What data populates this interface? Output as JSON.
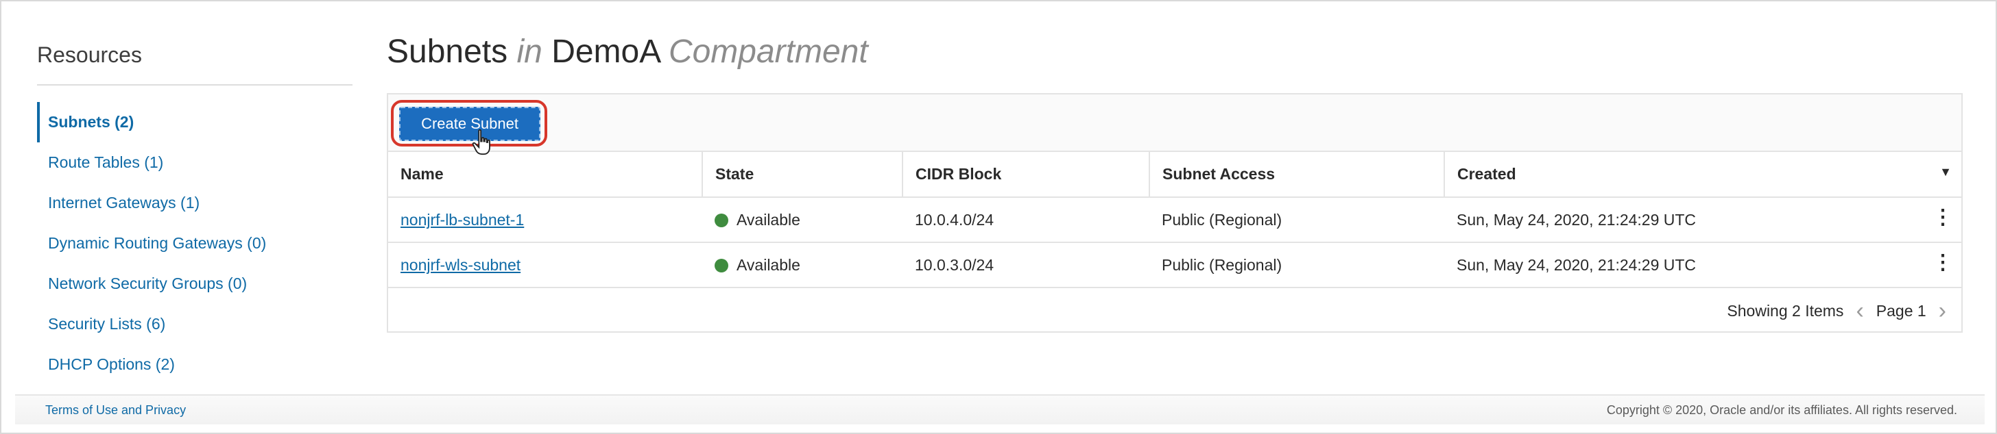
{
  "sidebar": {
    "title": "Resources",
    "items": [
      {
        "label": "Subnets (2)"
      },
      {
        "label": "Route Tables (1)"
      },
      {
        "label": "Internet Gateways (1)"
      },
      {
        "label": "Dynamic Routing Gateways (0)"
      },
      {
        "label": "Network Security Groups (0)"
      },
      {
        "label": "Security Lists (6)"
      },
      {
        "label": "DHCP Options (2)"
      }
    ]
  },
  "header": {
    "title_main": "Subnets",
    "title_in": "in",
    "title_compartment": "DemoA",
    "title_suffix": "Compartment"
  },
  "toolbar": {
    "create_label": "Create Subnet"
  },
  "table": {
    "columns": [
      "Name",
      "State",
      "CIDR Block",
      "Subnet Access",
      "Created"
    ],
    "rows": [
      {
        "name": "nonjrf-lb-subnet-1",
        "state": "Available",
        "cidr": "10.0.4.0/24",
        "access": "Public (Regional)",
        "created": "Sun, May 24, 2020, 21:24:29 UTC"
      },
      {
        "name": "nonjrf-wls-subnet",
        "state": "Available",
        "cidr": "10.0.3.0/24",
        "access": "Public (Regional)",
        "created": "Sun, May 24, 2020, 21:24:29 UTC"
      }
    ]
  },
  "pager": {
    "showing": "Showing 2 Items",
    "page": "Page 1"
  },
  "footer": {
    "terms": "Terms of Use and Privacy",
    "copyright": "Copyright © 2020, Oracle and/or its affiliates. All rights reserved."
  },
  "colors": {
    "accent": "#0f6aa6",
    "button": "#1c6dbf",
    "status_available": "#3f8c3f",
    "highlight": "#d7372b"
  }
}
